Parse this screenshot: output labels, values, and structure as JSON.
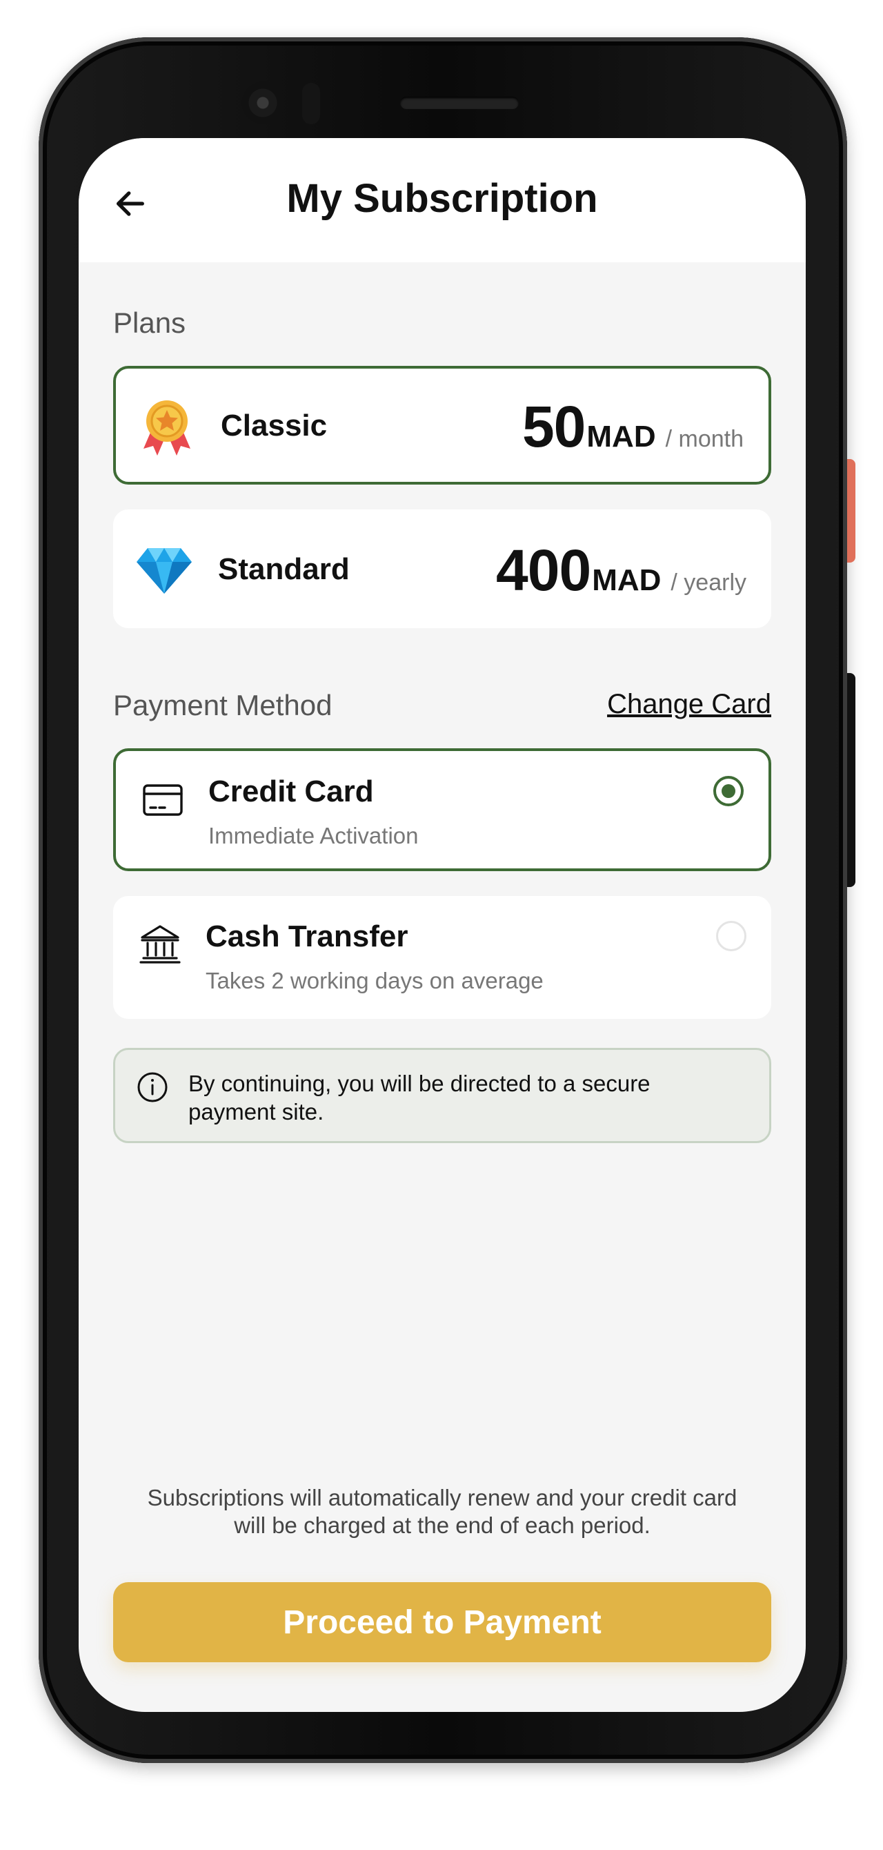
{
  "header": {
    "title": "My Subscription"
  },
  "plans_section": {
    "label": "Plans",
    "plans": [
      {
        "name": "Classic",
        "amount": "50",
        "currency": "MAD",
        "period": "/ month",
        "selected": true,
        "icon": "medal-icon"
      },
      {
        "name": "Standard",
        "amount": "400",
        "currency": "MAD",
        "period": "/ yearly",
        "selected": false,
        "icon": "diamond-icon"
      }
    ]
  },
  "payment_section": {
    "label": "Payment Method",
    "change_card": "Change Card",
    "methods": [
      {
        "name": "Credit Card",
        "subtitle": "Immediate Activation",
        "selected": true,
        "icon": "credit-card-icon"
      },
      {
        "name": "Cash Transfer",
        "subtitle": "Takes 2 working days on average",
        "selected": false,
        "icon": "bank-icon"
      }
    ]
  },
  "notice": {
    "text": "By continuing, you will be directed to a secure payment site.",
    "icon": "info-icon"
  },
  "disclaimer": "Subscriptions will automatically renew and your credit card will be charged at the end of each period.",
  "cta": {
    "label": "Proceed to Payment"
  },
  "colors": {
    "accent_green": "#3e6b35",
    "cta_gold": "#e1b446",
    "background": "#f5f5f5"
  }
}
